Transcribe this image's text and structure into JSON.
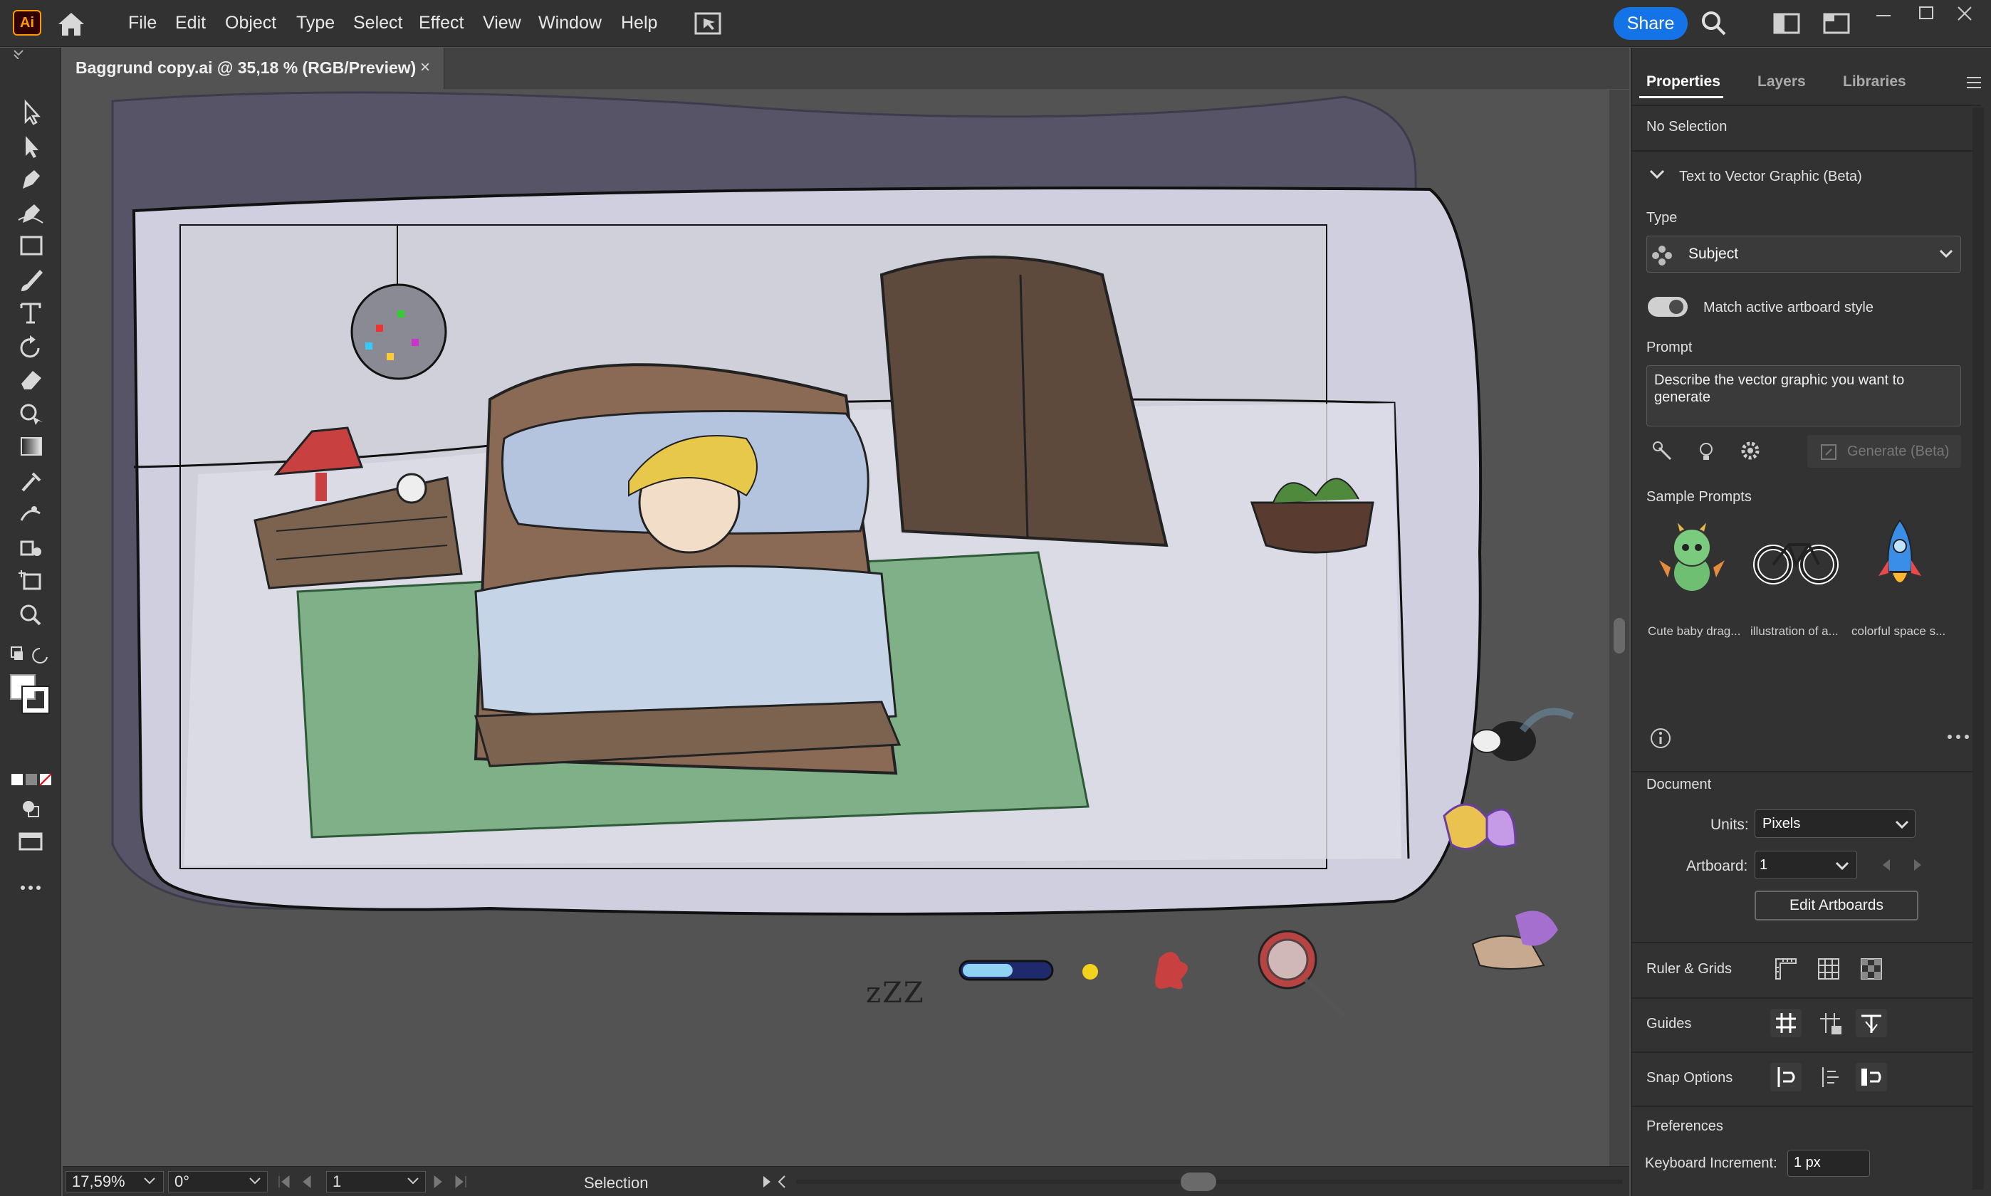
{
  "app": {
    "logo_text": "Ai",
    "brand_color": "#ff9a00",
    "accent": "#1473e6"
  },
  "menu": {
    "items": [
      "File",
      "Edit",
      "Object",
      "Type",
      "Select",
      "Effect",
      "View",
      "Window",
      "Help"
    ],
    "share_label": "Share"
  },
  "document": {
    "tab_title": "Baggrund copy.ai @ 35,18 % (RGB/Preview)",
    "close_glyph": "×"
  },
  "canvas": {
    "sleep_text": "zZZ",
    "stickers": [
      "mosquito",
      "butterfly",
      "hand-with-butterfly",
      "ladybug-with-magnifier",
      "red-splat",
      "yellow-dot",
      "progress-bar"
    ]
  },
  "status": {
    "zoom": "17,59%",
    "rotation": "0°",
    "artboard_number": "1",
    "tool_name": "Selection"
  },
  "panel": {
    "tabs": [
      "Properties",
      "Layers",
      "Libraries"
    ],
    "no_selection": "No Selection",
    "section_title": "Text to Vector Graphic (Beta)",
    "type_label": "Type",
    "type_value": "Subject",
    "match_style_label": "Match active artboard style",
    "prompt_label": "Prompt",
    "prompt_placeholder": "Describe the vector graphic you want to generate",
    "generate_label": "Generate (Beta)",
    "sample_prompts_label": "Sample Prompts",
    "samples": [
      {
        "label": "Cute baby drag...",
        "icon": "dragon-icon"
      },
      {
        "label": "illustration of a...",
        "icon": "bicycle-icon"
      },
      {
        "label": "colorful space s...",
        "icon": "rocket-icon"
      }
    ],
    "document_label": "Document",
    "units_label": "Units:",
    "units_value": "Pixels",
    "artboard_label": "Artboard:",
    "artboard_value": "1",
    "edit_artboards_label": "Edit Artboards",
    "ruler_label": "Ruler & Grids",
    "guides_label": "Guides",
    "snap_label": "Snap Options",
    "preferences_label": "Preferences",
    "keyboard_increment_label": "Keyboard Increment:",
    "keyboard_increment_value": "1 px"
  }
}
